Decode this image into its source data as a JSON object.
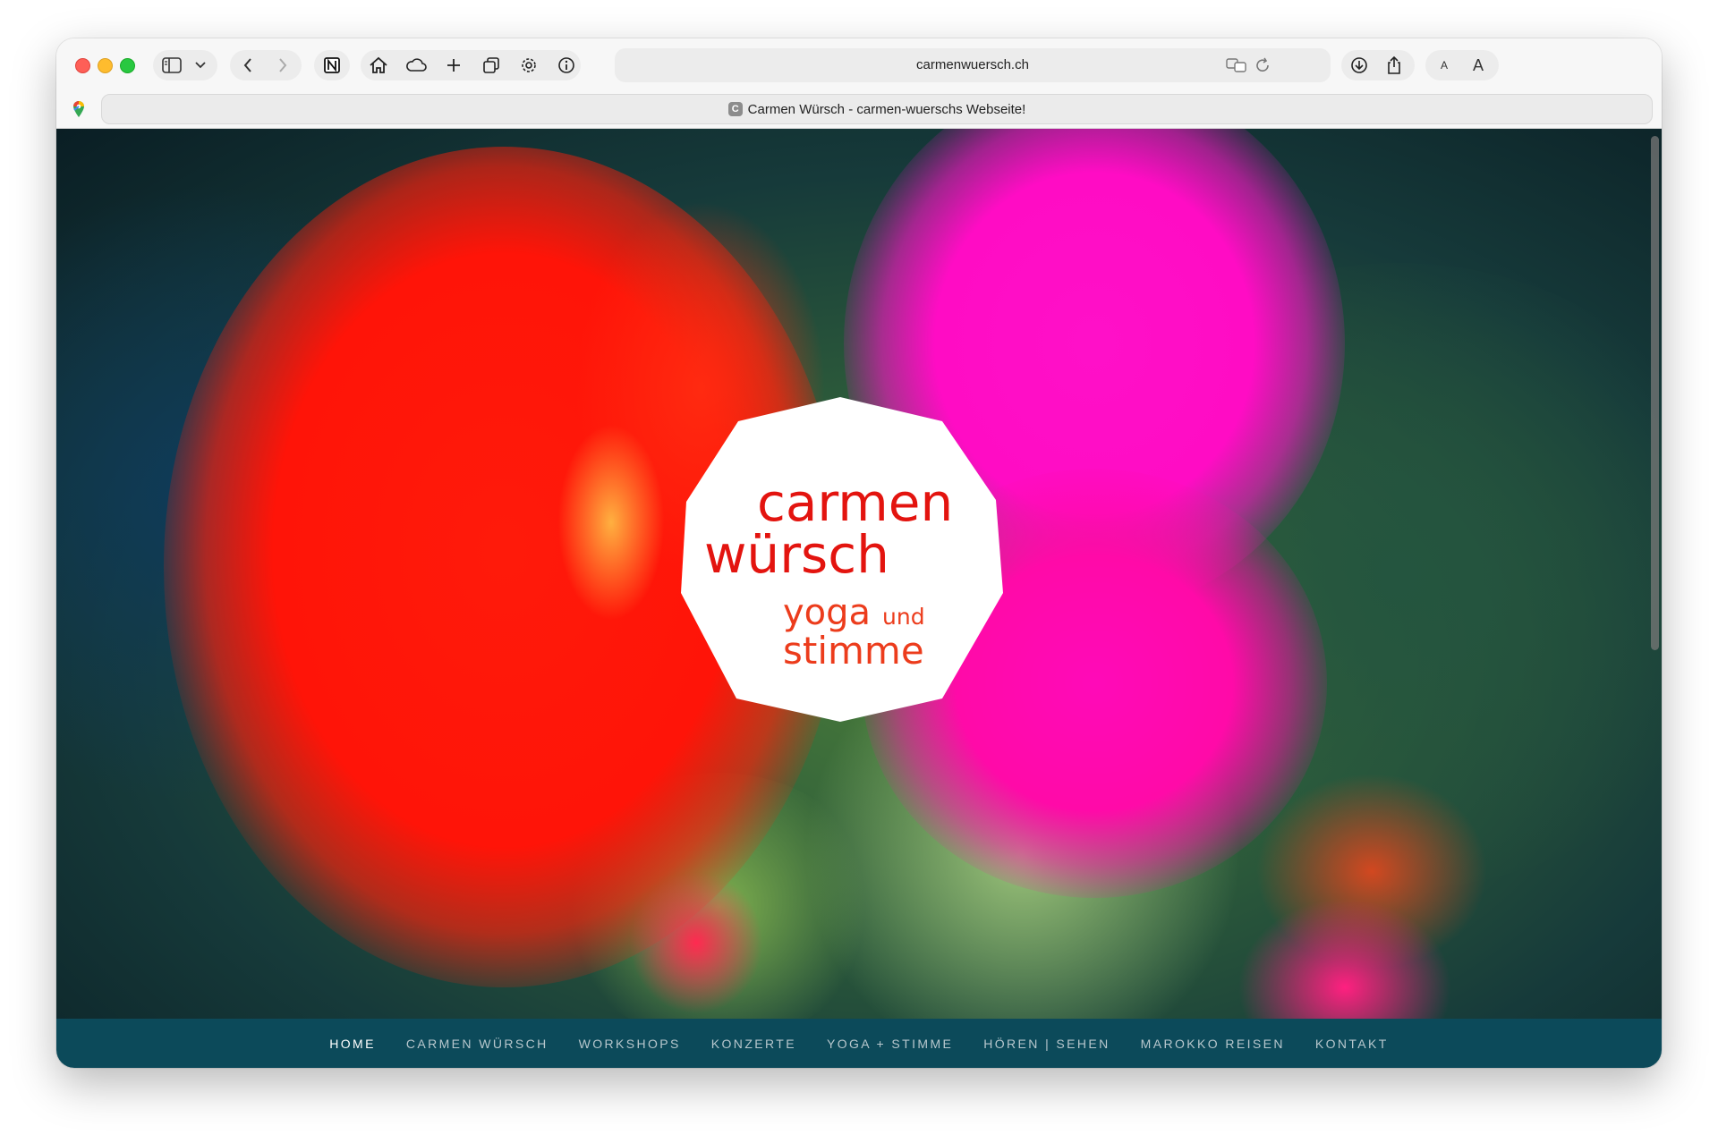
{
  "browser": {
    "url": "carmenwuersch.ch",
    "tab_title": "Carmen Würsch - carmen-wuerschs Webseite!",
    "favicon_letter": "C",
    "font_small_label": "A",
    "font_large_label": "A"
  },
  "logo": {
    "line1": "carmen",
    "line2": "würsch",
    "line3a": "yoga",
    "line3b": "und",
    "line4": "stimme"
  },
  "nav": {
    "items": [
      {
        "label": "HOME",
        "active": true
      },
      {
        "label": "CARMEN WÜRSCH",
        "active": false
      },
      {
        "label": "WORKSHOPS",
        "active": false
      },
      {
        "label": "KONZERTE",
        "active": false
      },
      {
        "label": "YOGA + STIMME",
        "active": false
      },
      {
        "label": "HÖREN | SEHEN",
        "active": false
      },
      {
        "label": "MAROKKO REISEN",
        "active": false
      },
      {
        "label": "KONTAKT",
        "active": false
      }
    ]
  },
  "colors": {
    "nav_bg": "#0c4a5a",
    "logo_red": "#e3140f",
    "logo_olive": "#7a6a20"
  }
}
